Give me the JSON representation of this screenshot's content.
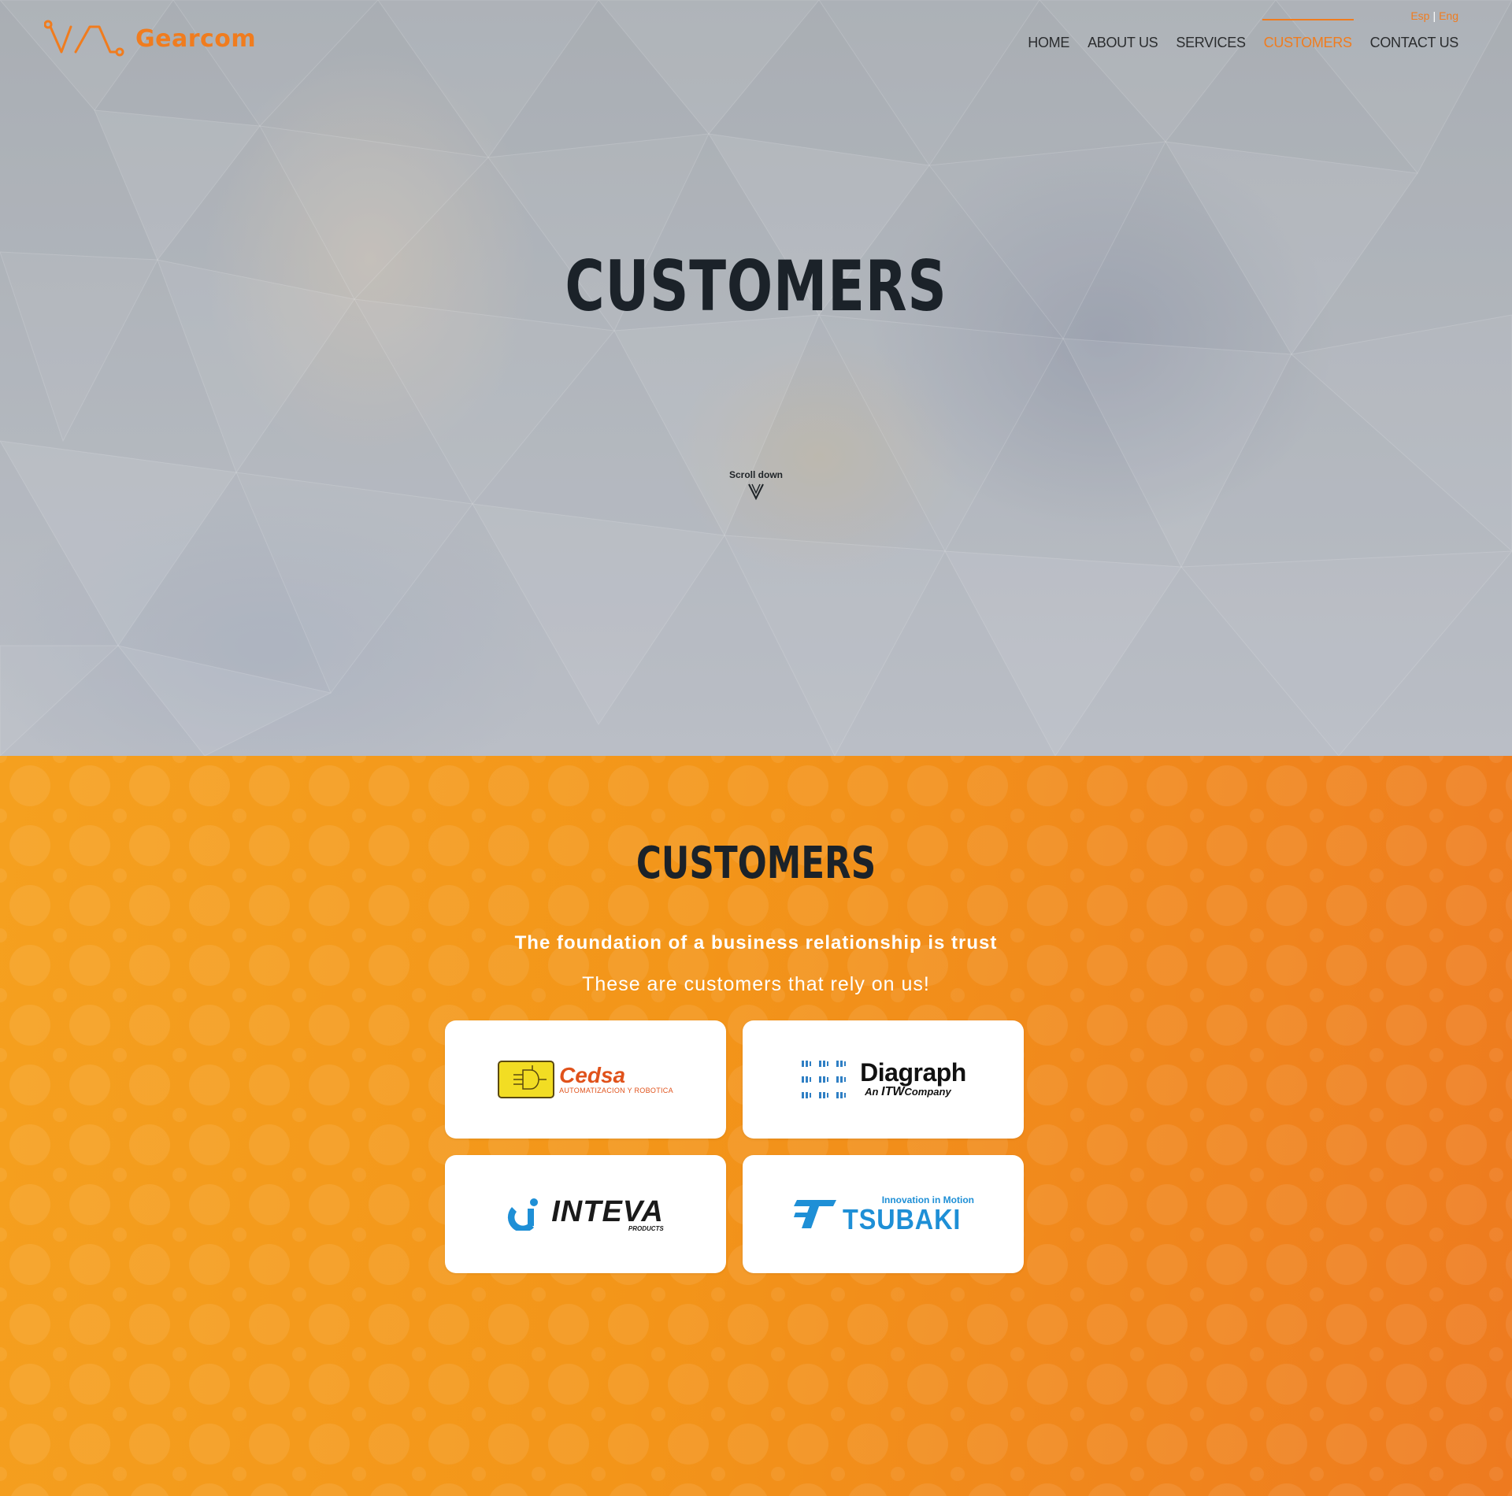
{
  "brand": {
    "name": "Gearcom",
    "accent_color": "#f07c1e"
  },
  "lang": {
    "esp": "Esp",
    "separator": "|",
    "eng": "Eng"
  },
  "nav": {
    "items": [
      {
        "label": "HOME",
        "active": false
      },
      {
        "label": "ABOUT US",
        "active": false
      },
      {
        "label": "SERVICES",
        "active": false
      },
      {
        "label": "CUSTOMERS",
        "active": true
      },
      {
        "label": "CONTACT US",
        "active": false
      }
    ]
  },
  "hero": {
    "title": "CUSTOMERS",
    "scroll_label": "Scroll down",
    "scroll_icon": "chevron-down-icon"
  },
  "section": {
    "title": "CUSTOMERS",
    "subtitle": "The foundation of a business relationship is trust",
    "tagline": "These are customers that rely on us!",
    "background_color": "#f39519"
  },
  "customers": [
    {
      "name": "Cedsa",
      "tagline": "AUTOMATIZACION Y ROBOTICA",
      "color": "#e0521b"
    },
    {
      "name": "Diagraph",
      "tagline_prefix": "An",
      "tagline_brand": "ITW",
      "tagline_suffix": "Company",
      "color": "#111111"
    },
    {
      "name": "INTEVA",
      "tagline": "PRODUCTS",
      "color": "#1a1a1a"
    },
    {
      "name": "TSUBAKI",
      "tagline": "Innovation in Motion",
      "color": "#1e8fd6"
    }
  ]
}
